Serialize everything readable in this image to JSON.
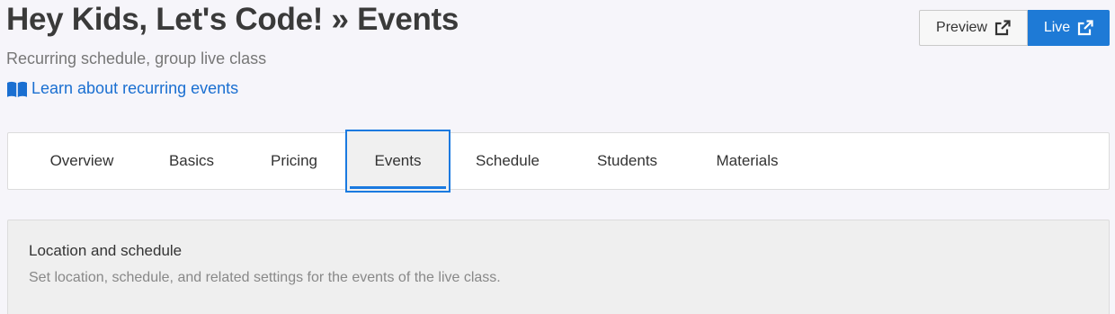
{
  "header": {
    "title": "Hey Kids, Let's Code! » Events",
    "subtitle": "Recurring schedule, group live class",
    "learn_link": {
      "label": "Learn about recurring events",
      "icon": "book-icon"
    }
  },
  "actions": {
    "preview_label": "Preview",
    "live_label": "Live",
    "icon": "external-link-icon"
  },
  "tabs": [
    {
      "label": "Overview",
      "active": false
    },
    {
      "label": "Basics",
      "active": false
    },
    {
      "label": "Pricing",
      "active": false
    },
    {
      "label": "Events",
      "active": true
    },
    {
      "label": "Schedule",
      "active": false
    },
    {
      "label": "Students",
      "active": false
    },
    {
      "label": "Materials",
      "active": false
    }
  ],
  "section": {
    "title": "Location and schedule",
    "description": "Set location, schedule, and related settings for the events of the live class."
  },
  "colors": {
    "accent": "#1e7ad6",
    "link": "#1a6fd1",
    "background": "#f6f5fa"
  }
}
